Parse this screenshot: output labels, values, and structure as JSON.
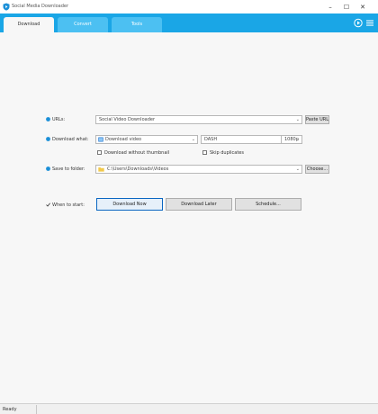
{
  "window": {
    "title": "Social Media Downloader",
    "minimize": "–",
    "maximize": "☐",
    "close": "✕",
    "icon": "shield-play-icon"
  },
  "tabs": [
    {
      "label": "Download",
      "active": true
    },
    {
      "label": "Convert",
      "active": false
    },
    {
      "label": "Tools",
      "active": false
    }
  ],
  "toolbar_icons": [
    "play-circle-icon",
    "hamburger-menu-icon"
  ],
  "url_row": {
    "label": "URLs:",
    "value": "Social Video Downloader",
    "paste_button": "Paste URL"
  },
  "download_row": {
    "label": "Download what:",
    "type_value": "Download video",
    "quality_value": "DASH",
    "resolution_value": "1080p",
    "option_left": "Download without thumbnail",
    "option_right": "Skip duplicates"
  },
  "save_row": {
    "label": "Save to folder:",
    "value": "C:\\Users\\Downloads\\Videos",
    "choose_button": "Choose..."
  },
  "when_row": {
    "label": "When to start:",
    "buttons": [
      "Download Now",
      "Download Later",
      "Schedule..."
    ]
  },
  "status": {
    "text": "Ready"
  },
  "colors": {
    "accent": "#1aa6e6",
    "tab_inactive": "#4cc0f2",
    "primary_border": "#0b66c2"
  }
}
